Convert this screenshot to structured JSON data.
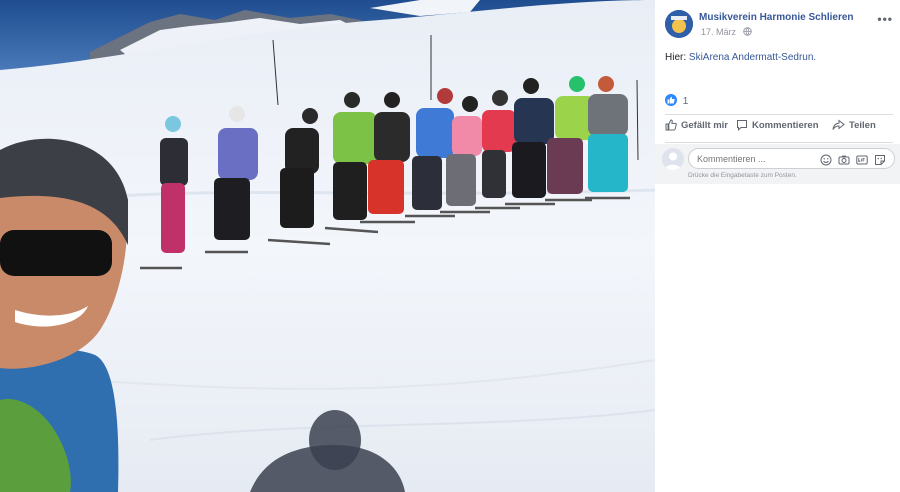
{
  "post": {
    "page_name": "Musikverein Harmonie Schlieren",
    "date": "17. März",
    "privacy_icon": "globe-icon",
    "more_icon": "more-options-icon",
    "text_prefix": "Hier:",
    "location_link": "SkiArena Andermatt-Sedrun."
  },
  "reactions": {
    "icon": "like-reaction-icon",
    "count": "1"
  },
  "actions": {
    "like_label": "Gefällt mir",
    "comment_label": "Kommentieren",
    "share_label": "Teilen"
  },
  "comment_box": {
    "placeholder": "Kommentieren ...",
    "hint": "Drücke die Eingabetaste zum Posten.",
    "icons": [
      "emoji-icon",
      "camera-icon",
      "gif-icon",
      "sticker-icon"
    ]
  },
  "colors": {
    "link": "#385898",
    "like_blue": "#2d88ff",
    "sky": "#2a4f8a",
    "snow": "#f4f6fa"
  }
}
